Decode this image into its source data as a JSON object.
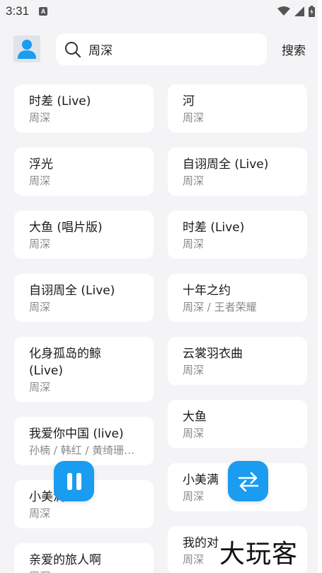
{
  "status_bar": {
    "time": "3:31",
    "notification_badge": "A"
  },
  "header": {
    "search_query": "周深",
    "search_button": "搜索"
  },
  "results": {
    "left": [
      {
        "title": "时差 (Live)",
        "artist": "周深"
      },
      {
        "title": "浮光",
        "artist": "周深"
      },
      {
        "title": "大鱼 (唱片版)",
        "artist": "周深"
      },
      {
        "title": "自诩周全 (Live)",
        "artist": "周深"
      },
      {
        "title": "化身孤岛的鲸\n(Live)",
        "artist": "周深"
      },
      {
        "title": "我爱你中国 (live)",
        "artist": "孙楠 / 韩红 / 黄绮珊…"
      },
      {
        "title": "小美满",
        "artist": "周深"
      },
      {
        "title": "亲爱的旅人啊",
        "artist": "周深"
      }
    ],
    "right": [
      {
        "title": "河",
        "artist": "周深"
      },
      {
        "title": "自诩周全 (Live)",
        "artist": "周深"
      },
      {
        "title": "时差 (Live)",
        "artist": "周深"
      },
      {
        "title": "十年之约",
        "artist": "周深 / 王者荣耀"
      },
      {
        "title": "云裳羽衣曲",
        "artist": "周深"
      },
      {
        "title": "大鱼",
        "artist": "周深"
      },
      {
        "title": "小美满",
        "artist": "周深"
      },
      {
        "title": "我的对",
        "artist": "周深"
      }
    ]
  },
  "watermark": "大玩客",
  "colors": {
    "accent": "#1a9cf0",
    "background": "#f4f4f6",
    "card": "#ffffff",
    "secondary_text": "#8a8a8a"
  },
  "icons": {
    "avatar": "person-icon",
    "search": "search-icon",
    "play_pause": "pause-icon",
    "mode": "repeat-swap-icon"
  }
}
